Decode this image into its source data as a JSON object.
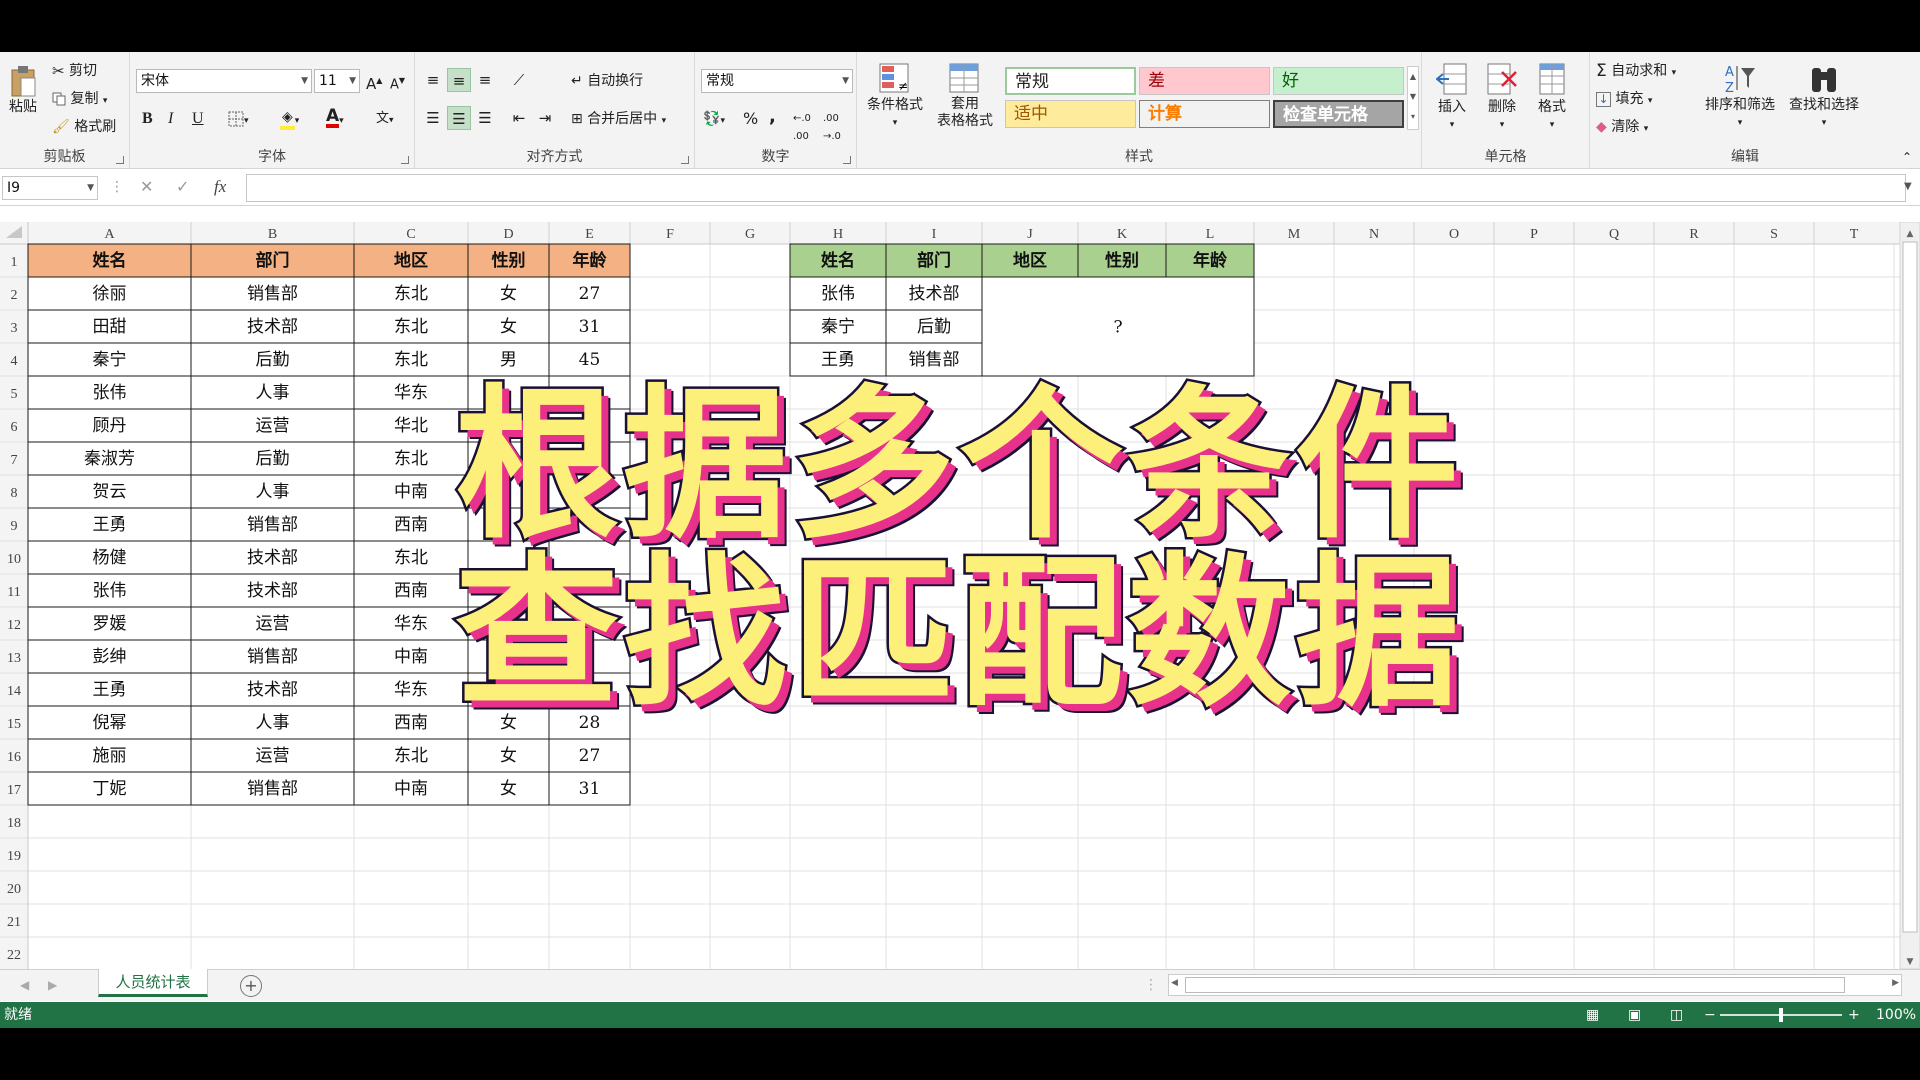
{
  "ribbon": {
    "clipboard": {
      "paste": "粘贴",
      "cut": "剪切",
      "copy": "复制",
      "format_painter": "格式刷",
      "label": "剪贴板"
    },
    "font": {
      "name": "宋体",
      "size": "11",
      "bold": "B",
      "italic": "I",
      "underline": "U",
      "label": "字体"
    },
    "align": {
      "wrap": "自动换行",
      "merge": "合并后居中",
      "label": "对齐方式"
    },
    "number": {
      "format": "常规",
      "label": "数字",
      "percent": "%",
      "comma": ","
    },
    "styles": {
      "cond": "条件格式",
      "table": [
        "套用",
        "表格格式"
      ],
      "cells": [
        "常规",
        "差",
        "好",
        "适中",
        "计算",
        "检查单元格"
      ],
      "label": "样式"
    },
    "cells": {
      "insert": "插入",
      "delete": "删除",
      "format": "格式",
      "label": "单元格"
    },
    "edit": {
      "autosum": "自动求和",
      "fill": "填充",
      "clear": "清除",
      "sort": "排序和筛选",
      "find": "查找和选择",
      "label": "编辑"
    }
  },
  "formula_bar": {
    "name_box": "I9",
    "fx": "fx",
    "value": ""
  },
  "columns": [
    "A",
    "B",
    "C",
    "D",
    "E",
    "F",
    "G",
    "H",
    "I",
    "J",
    "K",
    "L",
    "M",
    "N",
    "O",
    "P",
    "Q",
    "R",
    "S",
    "T"
  ],
  "rows": [
    "1",
    "2",
    "3",
    "4",
    "5",
    "6",
    "7",
    "8",
    "9",
    "10",
    "11",
    "12",
    "13",
    "14",
    "15",
    "16",
    "17",
    "18",
    "19",
    "20",
    "21",
    "22"
  ],
  "table1": {
    "header": [
      "姓名",
      "部门",
      "地区",
      "性别",
      "年龄"
    ],
    "rows": [
      [
        "徐丽",
        "销售部",
        "东北",
        "女",
        "27"
      ],
      [
        "田甜",
        "技术部",
        "东北",
        "女",
        "31"
      ],
      [
        "秦宁",
        "后勤",
        "东北",
        "男",
        "45"
      ],
      [
        "张伟",
        "人事",
        "华东",
        "",
        ""
      ],
      [
        "顾丹",
        "运营",
        "华北",
        "",
        ""
      ],
      [
        "秦淑芳",
        "后勤",
        "东北",
        "",
        ""
      ],
      [
        "贺云",
        "人事",
        "中南",
        "",
        ""
      ],
      [
        "王勇",
        "销售部",
        "西南",
        "",
        ""
      ],
      [
        "杨健",
        "技术部",
        "东北",
        "",
        ""
      ],
      [
        "张伟",
        "技术部",
        "西南",
        "",
        ""
      ],
      [
        "罗媛",
        "运营",
        "华东",
        "",
        ""
      ],
      [
        "彭绅",
        "销售部",
        "中南",
        "",
        ""
      ],
      [
        "王勇",
        "技术部",
        "华东",
        "",
        ""
      ],
      [
        "倪幂",
        "人事",
        "西南",
        "女",
        "28"
      ],
      [
        "施丽",
        "运营",
        "东北",
        "女",
        "27"
      ],
      [
        "丁妮",
        "销售部",
        "中南",
        "女",
        "31"
      ]
    ]
  },
  "table2": {
    "header": [
      "姓名",
      "部门",
      "地区",
      "性别",
      "年龄"
    ],
    "rows": [
      [
        "张伟",
        "技术部"
      ],
      [
        "秦宁",
        "后勤"
      ],
      [
        "王勇",
        "销售部"
      ]
    ],
    "merged_value": "?"
  },
  "sheet_tab": "人员统计表",
  "status": {
    "ready": "就绪",
    "zoom": "100%"
  },
  "overlay_title": [
    "根据多个条件",
    "查找匹配数据"
  ],
  "colors": {
    "header1": "#f4b183",
    "header2": "#a9d08e",
    "excel_green": "#217346",
    "overlay_fill": "#fcef7a",
    "overlay_shadow": "#e8318b"
  }
}
